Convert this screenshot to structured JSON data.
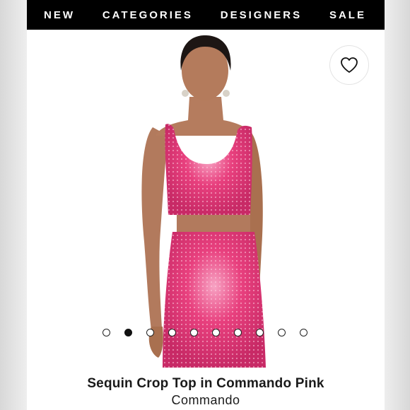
{
  "nav": {
    "items": [
      {
        "label": "NEW"
      },
      {
        "label": "CATEGORIES"
      },
      {
        "label": "DESIGNERS"
      },
      {
        "label": "SALE"
      }
    ]
  },
  "product": {
    "title": "Sequin Crop Top in Commando Pink",
    "brand": "Commando",
    "image_color": "#e8407e",
    "wishlist_icon": "heart-outline-icon"
  },
  "gallery": {
    "total_images": 10,
    "active_index": 2
  }
}
